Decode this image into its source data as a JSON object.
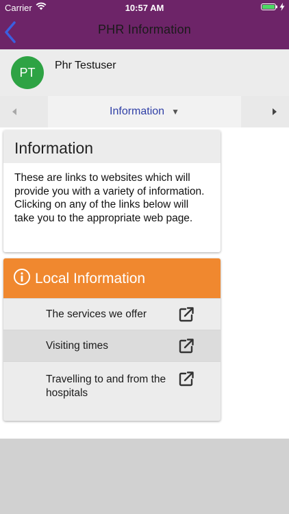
{
  "status_bar": {
    "carrier": "Carrier",
    "time": "10:57 AM",
    "battery_level": 1.0
  },
  "nav": {
    "title": "PHR Information",
    "back_icon": "chevron-left-icon"
  },
  "user": {
    "initials": "PT",
    "name": "Phr Testuser",
    "avatar_color": "#2ea344"
  },
  "section_selector": {
    "label": "Information",
    "caret": "▼",
    "prev_icon": "◀",
    "next_icon": "▶"
  },
  "info_card": {
    "title": "Information",
    "body": "These are links to websites which will provide you with a variety of information.  Clicking on any of the links below will take you to the appropriate web page."
  },
  "local_card": {
    "title": "Local Information",
    "header_color": "#f0882f",
    "links": [
      {
        "label": "The services we offer",
        "icon": "external-link-icon"
      },
      {
        "label": "Visiting times",
        "icon": "external-link-icon"
      },
      {
        "label": "Travelling to and from the hospitals",
        "icon": "external-link-icon"
      }
    ]
  },
  "colors": {
    "nav_bar": "#6d2468",
    "accent_blue": "#2f3fa6"
  }
}
